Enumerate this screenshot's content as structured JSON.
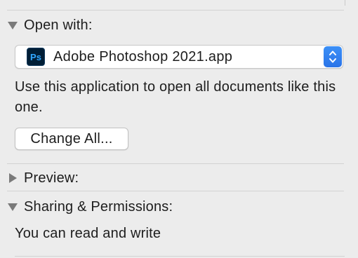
{
  "sections": {
    "open_with": {
      "title": "Open with:",
      "expanded": true,
      "app": {
        "name": "Adobe Photoshop 2021.app",
        "icon": "photoshop-icon",
        "icon_text": "Ps"
      },
      "description": "Use this application to open all documents like this one.",
      "change_all_label": "Change All..."
    },
    "preview": {
      "title": "Preview:",
      "expanded": false
    },
    "sharing": {
      "title": "Sharing & Permissions:",
      "expanded": true,
      "status": "You can read and write"
    }
  },
  "colors": {
    "background": "#ececec",
    "accent": "#2a74e8",
    "ps_icon_bg": "#001e36",
    "ps_icon_fg": "#31a8ff"
  }
}
